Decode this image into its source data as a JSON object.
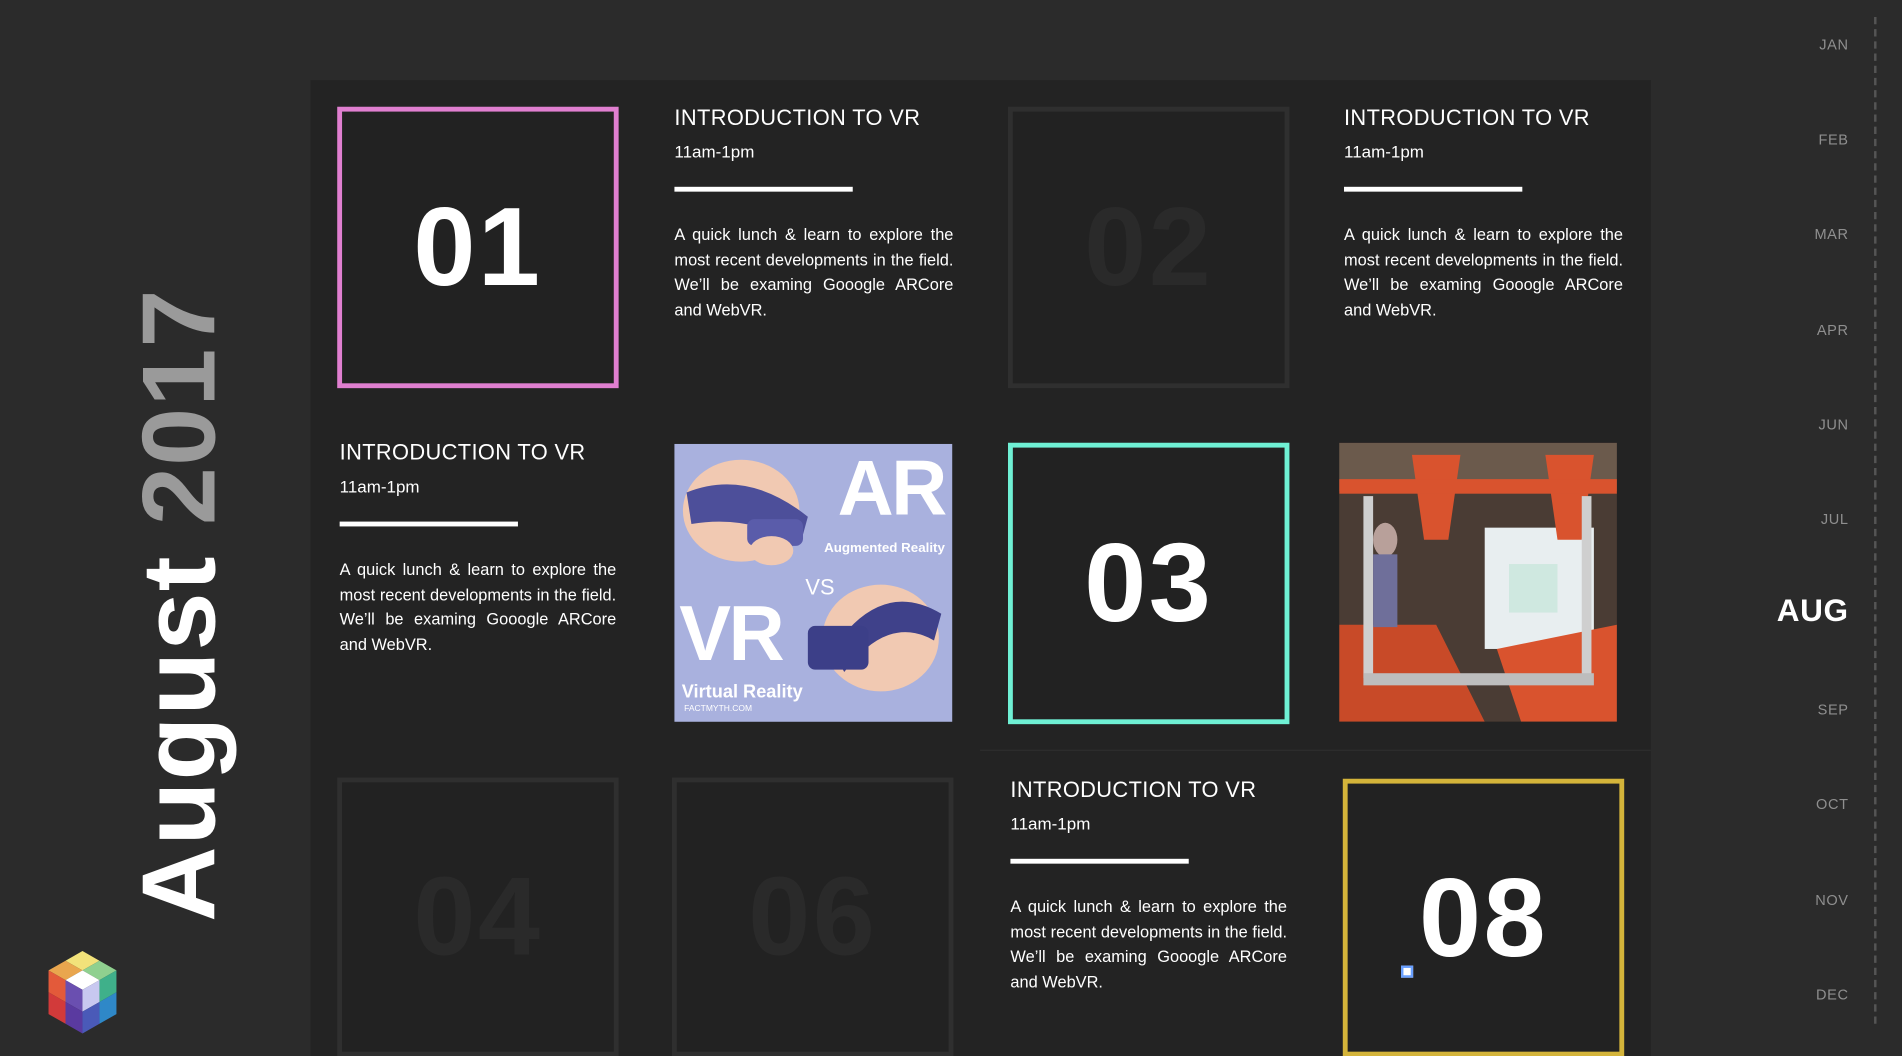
{
  "page": {
    "month_title": "August",
    "year_title": "2017"
  },
  "colors": {
    "background": "#2b2b2b",
    "panel": "#232323",
    "tile_01_border": "#e07fd0",
    "tile_03_border": "#6ff0d4",
    "tile_08_border": "#d4b43a",
    "dim_border": "#2f2f2f"
  },
  "tiles": [
    {
      "number": "01",
      "state": "active",
      "color": "#e07fd0"
    },
    {
      "number": "02",
      "state": "dim"
    },
    {
      "number": "03",
      "state": "active",
      "color": "#6ff0d4"
    },
    {
      "number": "04",
      "state": "dim"
    },
    {
      "number": "06",
      "state": "dim"
    },
    {
      "number": "08",
      "state": "active",
      "color": "#d4b43a"
    }
  ],
  "events": [
    {
      "title": "INTRODUCTION TO VR",
      "time": "11am-1pm",
      "description": "A quick lunch & learn to explore the most recent developments in the field. We’ll be examing Gooogle ARCore and WebVR."
    },
    {
      "title": "INTRODUCTION TO VR",
      "time": "11am-1pm",
      "description": "A quick lunch & learn to explore the most recent developments in the field. We’ll be examing Gooogle ARCore and WebVR."
    },
    {
      "title": "INTRODUCTION TO VR",
      "time": "11am-1pm",
      "description": "A quick lunch & learn to explore the most recent developments in the field. We’ll be examing Gooogle ARCore and WebVR."
    },
    {
      "title": "INTRODUCTION TO VR",
      "time": "11am-1pm",
      "description": "A quick lunch & learn to explore the most recent developments in the field. We’ll be examing Gooogle ARCore and WebVR."
    }
  ],
  "images": {
    "ar_vr": {
      "big_ar": "AR",
      "ar_caption": "Augmented Reality",
      "vs": "VS",
      "big_vr": "VR",
      "vr_caption": "Virtual Reality",
      "credit": "FACTMYTH.COM"
    },
    "printer_photo": {
      "icon": "3d-printer-photo"
    }
  },
  "timeline": {
    "months": [
      "JAN",
      "FEB",
      "MAR",
      "APR",
      "JUN",
      "JUL",
      "AUG",
      "SEP",
      "OCT",
      "NOV",
      "DEC"
    ],
    "current": "AUG"
  }
}
